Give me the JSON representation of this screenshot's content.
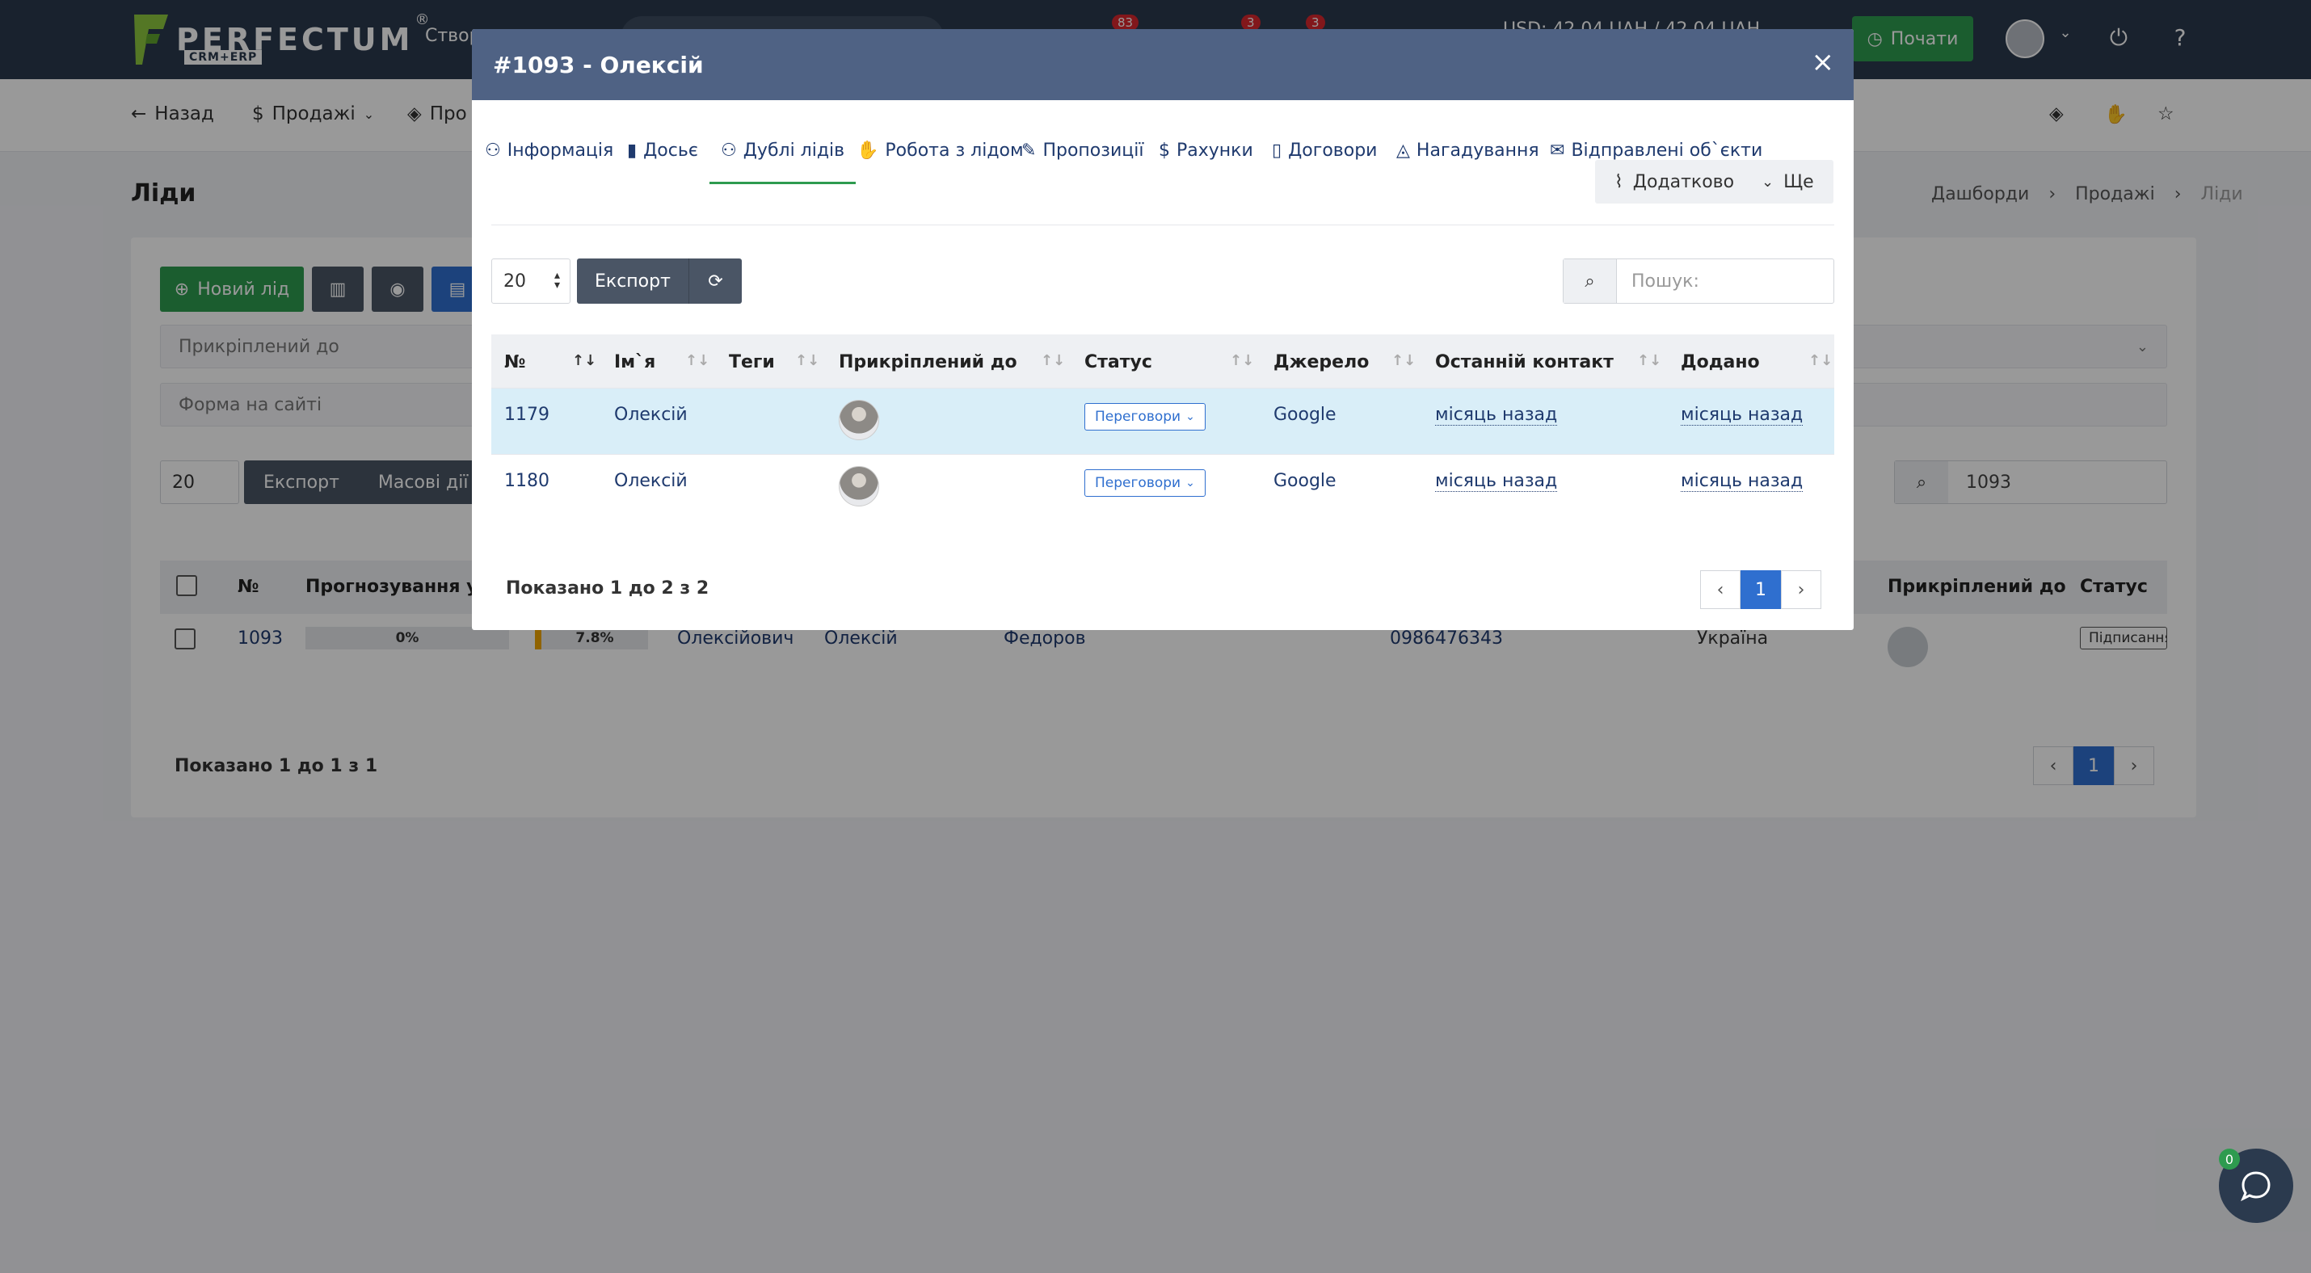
{
  "topbar": {
    "logo": "PERFECTUM",
    "logo_sub": "CRM+ERP",
    "create_label": "Створ",
    "badges": [
      "83",
      "3",
      "3"
    ],
    "rate": "USD: 42.04 UAH / 42.04 UAH",
    "start_button": "Почати"
  },
  "subnav": {
    "back": "Назад",
    "sales": "Продажі",
    "pro": "Про"
  },
  "page": {
    "title": "Ліди",
    "breadcrumbs": [
      "Дашборди",
      "Продажі",
      "Ліди"
    ]
  },
  "base": {
    "new_lead": "Новий лід",
    "filter_attached": "Прикріплений до",
    "filter_form": "Форма на сайті",
    "page_size": "20",
    "export": "Експорт",
    "bulk": "Масові дії",
    "search_value": "1093",
    "columns": {
      "no": "№",
      "forecast": "Прогнозування успіх",
      "attached": "Прикріплений до",
      "status": "Статус"
    },
    "row": {
      "id": "1093",
      "forecast": "0%",
      "percent": "7.8%",
      "middle_name": "Олексійович",
      "first_name": "Олексій",
      "last_name": "Федоров",
      "phone": "0986476343",
      "country": "Україна",
      "status": "Підписання"
    },
    "footer": "Показано 1 до 1 з 1",
    "page": "1"
  },
  "modal": {
    "title": "#1093 - Олексій",
    "close": "×",
    "tabs": [
      "Інформація",
      "Досьє",
      "Дублі лідів",
      "Робота з лідом",
      "Пропозиції",
      "Рахунки",
      "Договори",
      "Нагадування",
      "Відправлені об`єкти"
    ],
    "additional_button": "Додатково",
    "more_button": "Ще",
    "page_size": "20",
    "export": "Експорт",
    "search_placeholder": "Пошук:",
    "columns": [
      "№",
      "Ім`я",
      "Теги",
      "Прикріплений до",
      "Статус",
      "Джерело",
      "Останній контакт",
      "Додано"
    ],
    "rows": [
      {
        "id": "1179",
        "name": "Олексій",
        "tags": "",
        "status": "Переговори",
        "source": "Google",
        "last_contact": "місяць назад",
        "added": "місяць назад"
      },
      {
        "id": "1180",
        "name": "Олексій",
        "tags": "",
        "status": "Переговори",
        "source": "Google",
        "last_contact": "місяць назад",
        "added": "місяць назад"
      }
    ],
    "footer": "Показано 1 до 2 з 2",
    "page": "1"
  },
  "chat": {
    "badge": "0"
  },
  "colors": {
    "header": "#2b3a4e",
    "modal_header": "#4f6284",
    "accent_green": "#2e9b4f",
    "accent_blue": "#2f6fcf",
    "row_highlight": "#d9eef8"
  }
}
